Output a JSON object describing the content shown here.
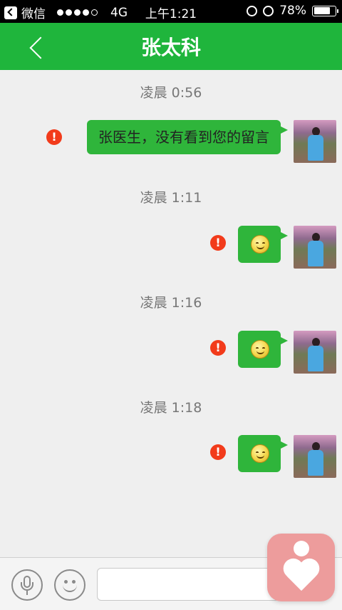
{
  "status_bar": {
    "back_app": "微信",
    "carrier": "4G",
    "time": "上午1:21",
    "battery": "78%",
    "battery_level": 0.78,
    "signal_full": 4,
    "signal_total": 5
  },
  "nav": {
    "title": "张太科",
    "back_icon": "chevron-left-icon"
  },
  "messages": [
    {
      "timestamp": "凌晨 0:56",
      "type": "text",
      "text": "张医生，没有看到您的留言",
      "error": "!"
    },
    {
      "timestamp": "凌晨 1:11",
      "type": "emoji",
      "text": "",
      "error": "!"
    },
    {
      "timestamp": "凌晨 1:16",
      "type": "emoji",
      "text": "",
      "error": "!"
    },
    {
      "timestamp": "凌晨 1:18",
      "type": "emoji",
      "text": "",
      "error": "!"
    }
  ],
  "input_bar": {
    "placeholder": "",
    "voice_icon": "microphone-icon",
    "emoji_icon": "smiley-face-icon"
  },
  "colors": {
    "nav_green": "#1fb53c",
    "bubble_green": "#2fb53b",
    "error_red": "#f23b1b",
    "floating_button": "#ed9c9c"
  }
}
